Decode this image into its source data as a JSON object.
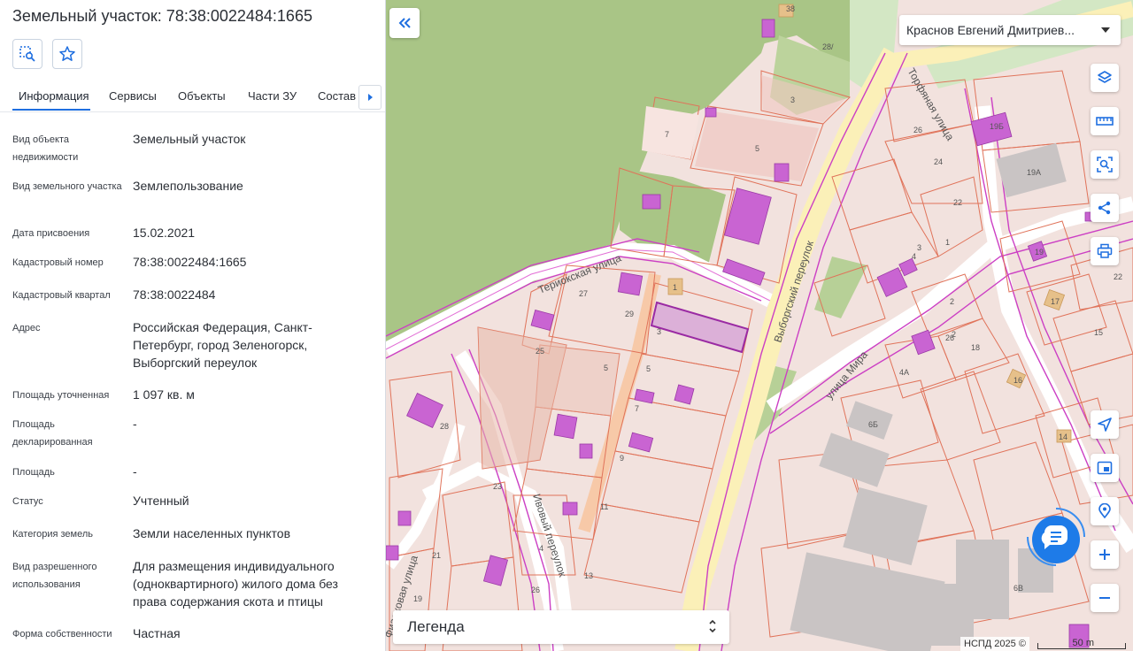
{
  "panel": {
    "title": "Земельный участок: 78:38:0022484:1665",
    "tabs": [
      {
        "label": "Информация"
      },
      {
        "label": "Сервисы"
      },
      {
        "label": "Объекты"
      },
      {
        "label": "Части ЗУ"
      },
      {
        "label": "Состав"
      }
    ],
    "rows": [
      {
        "label": "Вид объекта недвижимости",
        "value": "Земельный участок"
      },
      {
        "label": "Вид земельного участка",
        "value": "Землепользование"
      },
      {
        "label": "Дата присвоения",
        "value": "15.02.2021"
      },
      {
        "label": "Кадастровый номер",
        "value": "78:38:0022484:1665"
      },
      {
        "label": "Кадастровый квартал",
        "value": "78:38:0022484"
      },
      {
        "label": "Адрес",
        "value": "Российская Федерация, Санкт-Петербург, город Зеленогорск, Выборгский переулок"
      },
      {
        "label": "Площадь уточненная",
        "value": "1 097 кв. м"
      },
      {
        "label": "Площадь декларированная",
        "value": "-"
      },
      {
        "label": "Площадь",
        "value": "-"
      },
      {
        "label": "Статус",
        "value": "Учтенный"
      },
      {
        "label": "Категория земель",
        "value": "Земли населенных пунктов"
      },
      {
        "label": "Вид разрешенного использования",
        "value": "Для размещения индивидуального (одноквартирного) жилого дома без права содержания скота и птицы"
      },
      {
        "label": "Форма собственности",
        "value": "Частная"
      }
    ]
  },
  "map": {
    "user_select": "Краснов Евгений Дмитриев...",
    "legend_label": "Легенда",
    "attribution": "НСПД 2025 ©",
    "scale_label": "50 m",
    "streets": {
      "teriokskaya": "Териокская улица",
      "vyborgsky": "Выборгский переулок",
      "torfyanaya": "Торфяная улица",
      "mira": "улица Мира",
      "ivovy": "Ивовый переулок",
      "fialkovaya": "Фиалковая улица"
    },
    "numbers": [
      "38",
      "28/",
      "7",
      "3",
      "5",
      "26",
      "24",
      "22",
      "19Б",
      "19А",
      "1",
      "27",
      "1",
      "29",
      "3",
      "25",
      "5",
      "5",
      "7",
      "9",
      "11",
      "13",
      "23",
      "21",
      "19",
      "26",
      "28",
      "2",
      "4",
      "3",
      "2",
      "26",
      "18",
      "17",
      "15",
      "22",
      "16",
      "4А",
      "6Б",
      "14",
      "6В",
      "19",
      "4"
    ],
    "colors": {
      "forest": "#a9c586",
      "parcel_fill": "#f2ddd9",
      "parcel_border": "#e0735a",
      "building": "#c964d2",
      "road": "#fbf0b8",
      "accent": "#1f6fe0"
    }
  },
  "icons": {
    "panel_tools": [
      "select-area-icon",
      "star-icon"
    ],
    "map_tools": [
      "layers-icon",
      "ruler-icon",
      "search-area-icon",
      "share-icon",
      "print-icon",
      "navigate-icon",
      "window-icon",
      "location-pin-icon",
      "zoom-in-icon",
      "zoom-out-icon"
    ]
  }
}
